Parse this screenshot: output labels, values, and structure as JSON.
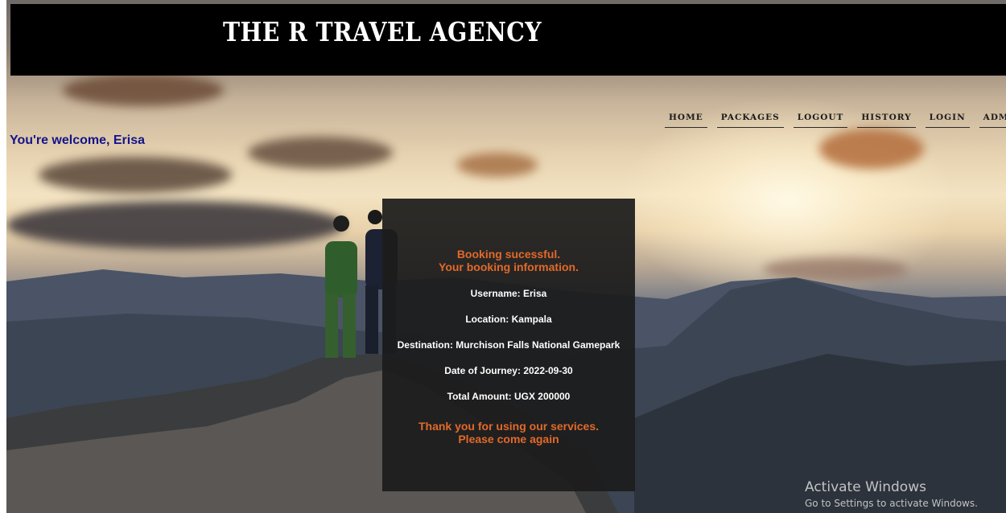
{
  "header": {
    "title": "THE R TRAVEL AGENCY"
  },
  "welcome": "You're welcome, Erisa",
  "nav": [
    "HOME",
    "PACKAGES",
    "LOGOUT",
    "HISTORY",
    "LOGIN",
    "ADMIN"
  ],
  "booking": {
    "status_line1": "Booking sucessful.",
    "status_line2": "Your booking information.",
    "username": "Username: Erisa",
    "location": "Location: Kampala",
    "destination": "Destination: Murchison Falls National Gamepark",
    "date": "Date of Journey: 2022-09-30",
    "amount": "Total Amount: UGX 200000",
    "thanks_line1": "Thank you for using our services.",
    "thanks_line2": "Please come again"
  },
  "windows_watermark": {
    "title": "Activate Windows",
    "subtitle": "Go to Settings to activate Windows."
  },
  "colors": {
    "header_bg": "#000000",
    "accent_orange": "#e2692a",
    "welcome_text": "#14148a",
    "card_bg": "#1c1c1c"
  }
}
